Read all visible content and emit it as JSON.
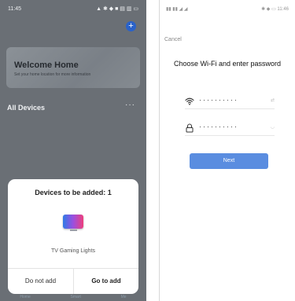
{
  "left": {
    "status_time": "11:45",
    "status_icons": "▲ ✱ ◆ ■ ▤ ▥ ▭",
    "welcome": {
      "title": "Welcome Home",
      "subtitle": "Set your home location for more information"
    },
    "devices_title": "All Devices",
    "devices_more": "···",
    "sheet": {
      "title": "Devices to be added: 1",
      "device_name": "TV Gaming Lights",
      "cancel_label": "Do not add",
      "confirm_label": "Go to add"
    },
    "tabs": [
      "Home",
      "Smart",
      "Me"
    ]
  },
  "right": {
    "status_left": "▮▮ ▮▮ ◢ ◢",
    "status_right": "✱ ◆ ▭ 11:46",
    "cancel_label": "Cancel",
    "title": "Choose Wi-Fi and enter password",
    "ssid_value": "··········",
    "ssid_action": "⇄",
    "password_value": "··········",
    "password_action": "◡",
    "next_label": "Next"
  }
}
